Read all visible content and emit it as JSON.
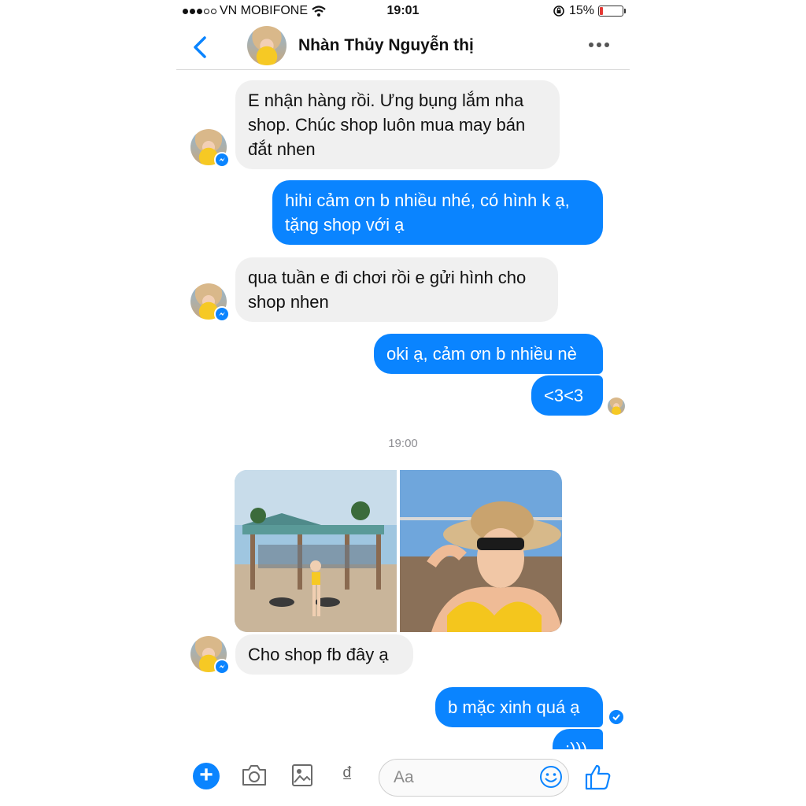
{
  "status_bar": {
    "carrier": "VN MOBIFONE",
    "time": "19:01",
    "battery_text": "15%",
    "battery_level": 0.15,
    "signal_bars": 3
  },
  "header": {
    "contact_name": "Nhàn Thủy Nguyễn thị",
    "back_icon": "chevron-left-icon",
    "more_icon": "more-horizontal-icon"
  },
  "messages": [
    {
      "from": "contact",
      "text": "E nhận hàng rồi. Ưng bụng lắm nha shop. Chúc shop luôn mua may bán đắt nhen"
    },
    {
      "from": "me",
      "text": "hihi cảm ơn b nhiều nhé, có hình k ạ, tặng shop với ạ"
    },
    {
      "from": "contact",
      "text": "qua tuần e đi chơi rồi e gửi hình cho shop nhen"
    },
    {
      "from": "me",
      "text": "oki ạ, cảm ơn b nhiều nè"
    },
    {
      "from": "me",
      "text": "<3<3"
    },
    {
      "from": "contact",
      "text": "Cho shop fb đây ạ"
    },
    {
      "from": "me",
      "text": "b mặc xinh quá ạ"
    },
    {
      "from": "me",
      "text": ":)))"
    }
  ],
  "timestamp": "19:00",
  "photos": [
    "beach-hut-photo",
    "sunhat-selfie-photo"
  ],
  "composer": {
    "placeholder": "Aa",
    "currency_symbol": "₫",
    "icons": [
      "plus-icon",
      "camera-icon",
      "gallery-icon",
      "dong-icon",
      "emoji-icon",
      "thumbs-up-icon"
    ]
  },
  "colors": {
    "accent": "#0a84ff",
    "incoming_bubble": "#f0f0f0",
    "battery_low": "#e53935"
  }
}
